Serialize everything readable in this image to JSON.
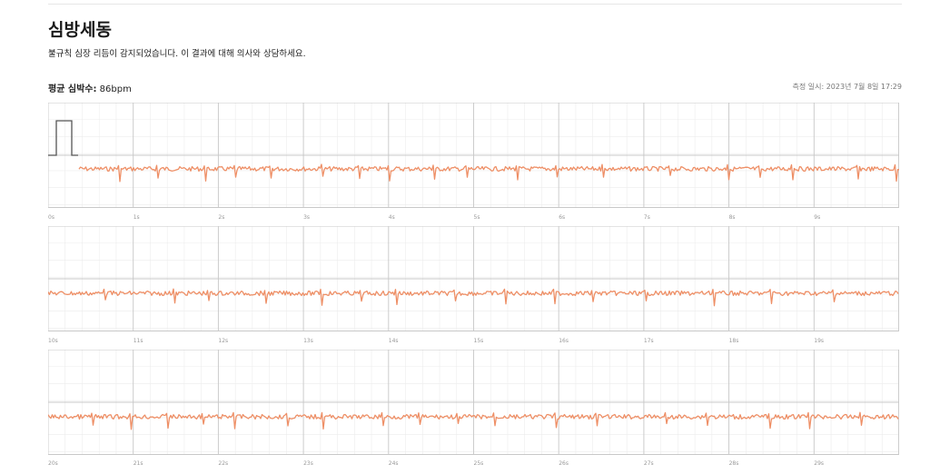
{
  "title": "심방세동",
  "description": "불규칙 심장 리듬이 감지되었습니다. 이 결과에 대해 의사와 상담하세요.",
  "avg_heart_rate": {
    "label": "평균 심박수:",
    "value": "86bpm"
  },
  "measured_at": "측정 일시: 2023년 7월 8일 17:29",
  "colors": {
    "trace": "#ee8f66",
    "grid_major": "#c8c8c8",
    "grid_minor": "#ececec",
    "calibration": "#555555"
  },
  "strips": [
    {
      "ticks": [
        "0s",
        "1s",
        "2s",
        "3s",
        "4s",
        "5s",
        "6s",
        "7s",
        "8s",
        "9s"
      ],
      "has_calibration_pulse": true
    },
    {
      "ticks": [
        "10s",
        "11s",
        "12s",
        "13s",
        "14s",
        "15s",
        "16s",
        "17s",
        "18s",
        "19s"
      ],
      "has_calibration_pulse": false
    },
    {
      "ticks": [
        "20s",
        "21s",
        "22s",
        "23s",
        "24s",
        "25s",
        "26s",
        "27s",
        "28s",
        "29s"
      ],
      "has_calibration_pulse": false
    }
  ]
}
